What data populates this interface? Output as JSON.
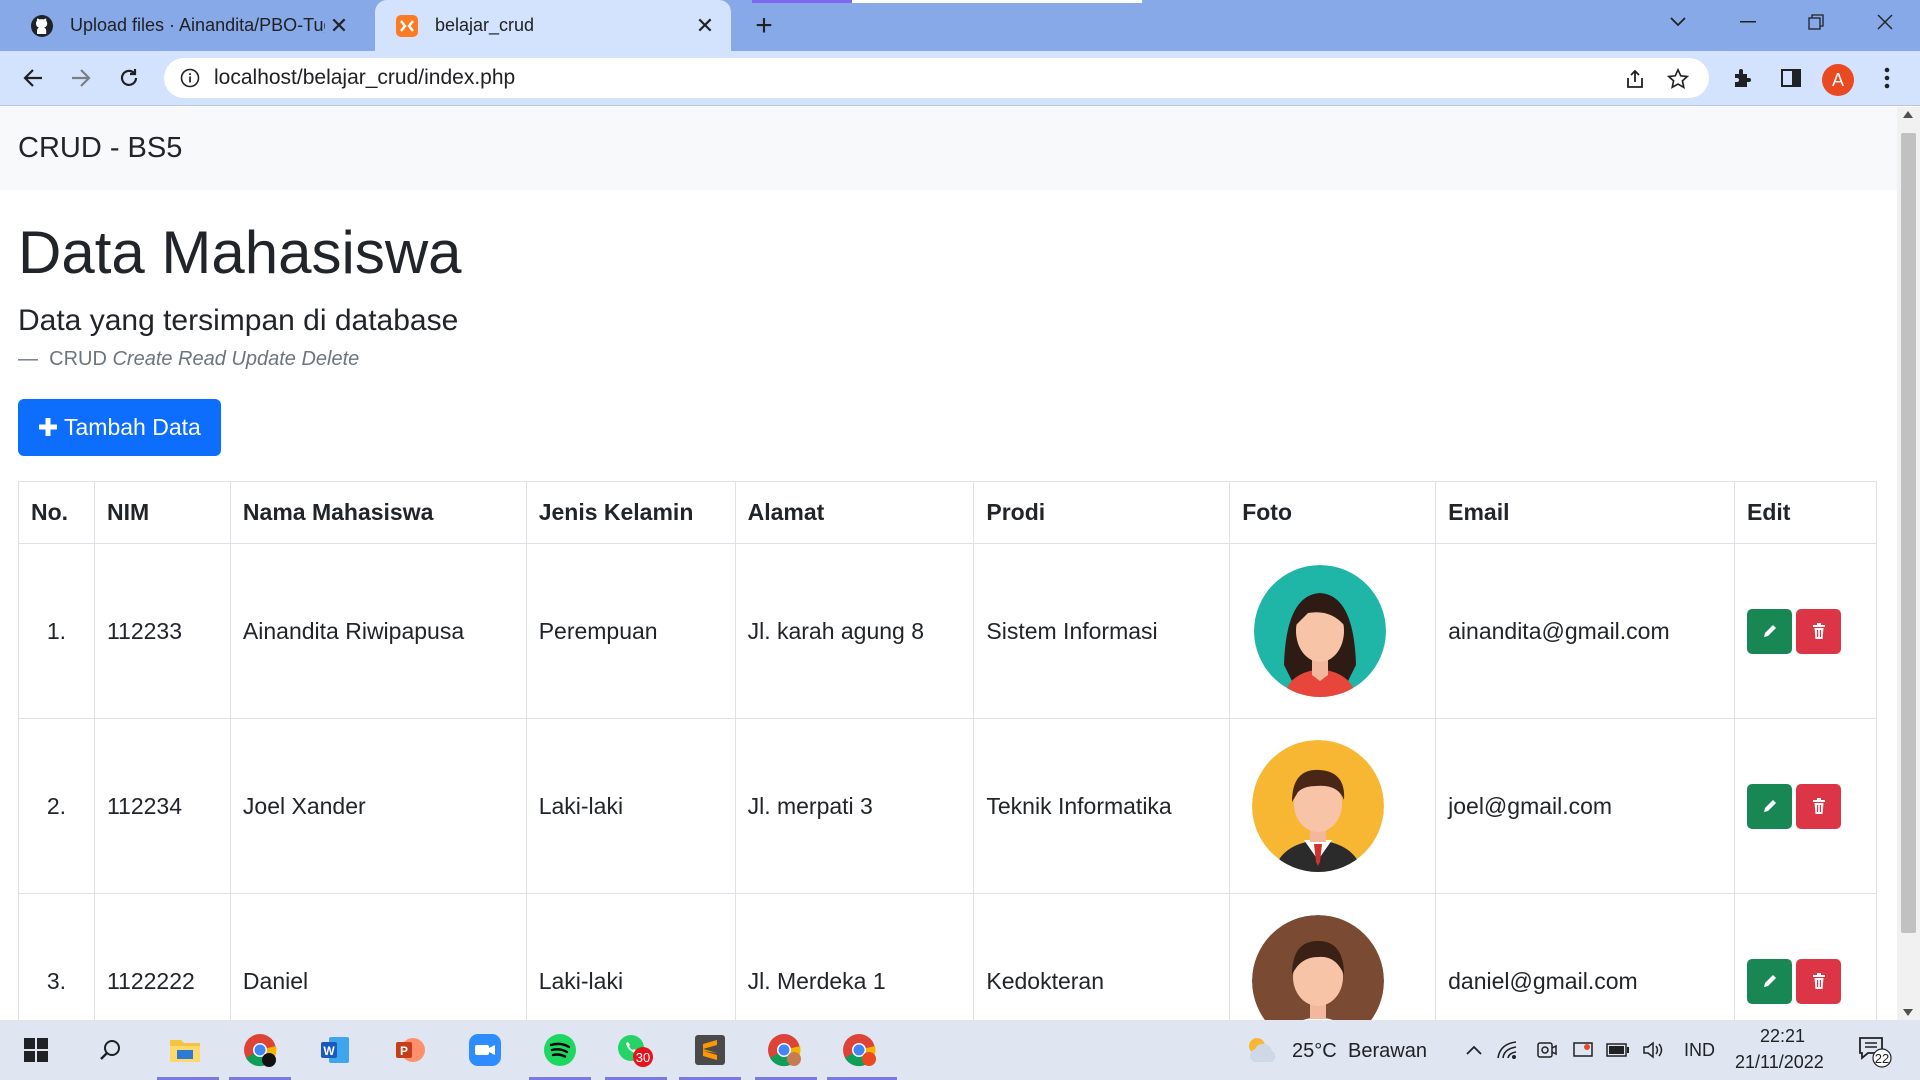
{
  "browser": {
    "tabs": [
      {
        "title": "Upload files · Ainandita/PBO-Tug",
        "active": false
      },
      {
        "title": "belajar_crud",
        "active": true
      }
    ],
    "url": "localhost/belajar_crud/index.php",
    "profile_initial": "A"
  },
  "navbar": {
    "brand": "CRUD - BS5"
  },
  "page": {
    "title": "Data Mahasiswa",
    "subtitle": "Data yang tersimpan di database",
    "footer_prefix": "CRUD",
    "footer_em": "Create Read Update Delete",
    "add_button": "Tambah Data"
  },
  "table": {
    "headers": [
      "No.",
      "NIM",
      "Nama Mahasiswa",
      "Jenis Kelamin",
      "Alamat",
      "Prodi",
      "Foto",
      "Email",
      "Edit"
    ],
    "rows": [
      {
        "no": "1.",
        "nim": "112233",
        "nama": "Ainandita Riwipapusa",
        "jk": "Perempuan",
        "alamat": "Jl. karah agung 8",
        "prodi": "Sistem Informasi",
        "foto": "female-avatar",
        "email": "ainandita@gmail.com"
      },
      {
        "no": "2.",
        "nim": "112234",
        "nama": "Joel Xander",
        "jk": "Laki-laki",
        "alamat": "Jl. merpati 3",
        "prodi": "Teknik Informatika",
        "foto": "male-avatar-suit",
        "email": "joel@gmail.com"
      },
      {
        "no": "3.",
        "nim": "1122222",
        "nama": "Daniel",
        "jk": "Laki-laki",
        "alamat": "Jl. Merdeka 1",
        "prodi": "Kedokteran",
        "foto": "male-avatar",
        "email": "daniel@gmail.com"
      }
    ]
  },
  "taskbar": {
    "weather_temp": "25°C",
    "weather_desc": "Berawan",
    "language": "IND",
    "time": "22:21",
    "date": "21/11/2022",
    "whatsapp_badge": "30",
    "notification_count": "22"
  },
  "colors": {
    "primary": "#0d6efd",
    "success": "#198754",
    "danger": "#dc3545",
    "tabstrip": "#87a9e8",
    "toolbar": "#d3e3fd"
  }
}
